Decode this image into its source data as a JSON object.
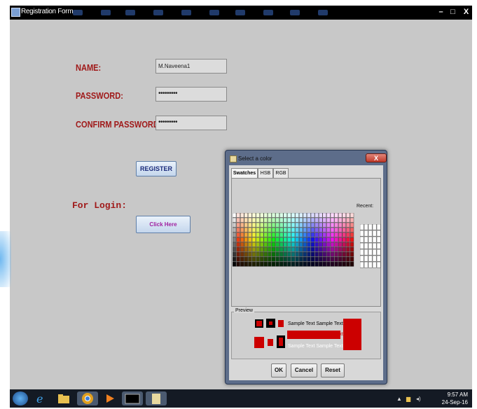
{
  "window": {
    "title": "Registration Form",
    "minimize_label": "–",
    "maximize_label": "□",
    "close_label": "X"
  },
  "form": {
    "name_label": "NAME:",
    "name_value": "M.Naveena1",
    "password_label": "PASSWORD:",
    "password_value": "•••••••••",
    "confirm_label": "CONFIRM PASSWORD:",
    "confirm_value": "•••••••••",
    "register_label": "REGISTER",
    "login_label": "For Login:",
    "click_here_label": "Click Here"
  },
  "colors": {
    "label_text": "#a01a1a",
    "register_text": "#1a2a7a",
    "click_here_text": "#a020a0",
    "preview_color": "#cc0000"
  },
  "color_dialog": {
    "title": "Select a color",
    "close_label": "X",
    "tabs": [
      {
        "label": "Swatches",
        "active": true
      },
      {
        "label": "HSB",
        "active": false
      },
      {
        "label": "RGB",
        "active": false
      }
    ],
    "recent_label": "Recent:",
    "preview_label": "Preview",
    "sample_text": "Sample Text  Sample Text",
    "buttons": {
      "ok": "OK",
      "cancel": "Cancel",
      "reset": "Reset"
    }
  },
  "taskbar": {
    "items": [
      "start-orb",
      "internet-explorer",
      "file-explorer",
      "chrome",
      "media-player",
      "command-prompt",
      "java-app"
    ],
    "clock_time": "9:57 AM",
    "clock_date": "24-Sep-16"
  }
}
